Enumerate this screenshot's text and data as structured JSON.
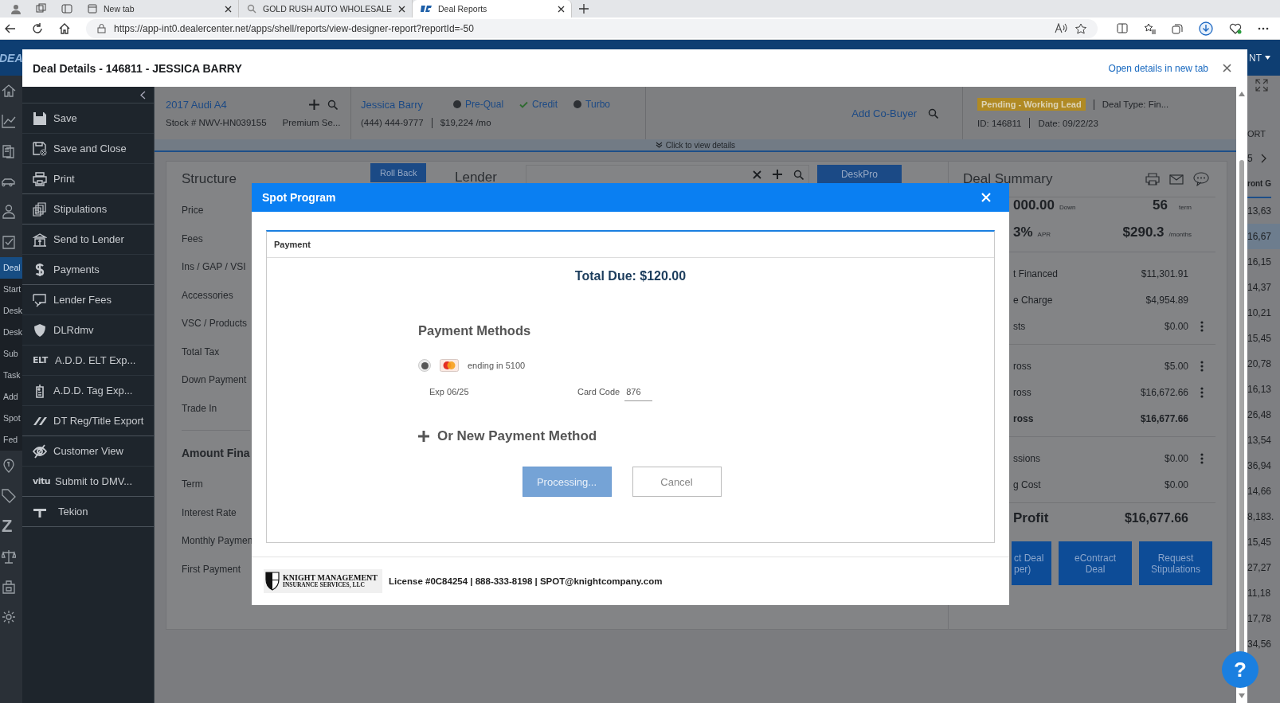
{
  "browser": {
    "tabs": [
      {
        "title": "New tab",
        "selected": false
      },
      {
        "title": "GOLD RUSH AUTO WHOLESALE",
        "selected": false
      },
      {
        "title": "Deal Reports",
        "selected": true
      }
    ],
    "url": "https://app-int0.dealercenter.net/apps/shell/reports/view-designer-report?reportId=-50"
  },
  "app_bar": {
    "logo": "DEA",
    "user": "NT"
  },
  "app_nav": {
    "top_icons": [
      {
        "kind": "home"
      },
      {
        "kind": "chart"
      },
      {
        "kind": "doc"
      },
      {
        "kind": "car"
      },
      {
        "kind": "person"
      },
      {
        "kind": "check"
      }
    ],
    "items": [
      {
        "label": "Deal",
        "selected": true
      },
      {
        "label": "Start",
        "selected": false
      },
      {
        "label": "Desk",
        "selected": false
      },
      {
        "label": "Desk",
        "selected": false
      },
      {
        "label": "Sub",
        "selected": false
      },
      {
        "label": "Task",
        "selected": false
      },
      {
        "label": "Add",
        "selected": false
      },
      {
        "label": "Spot",
        "selected": false
      },
      {
        "label": "Fed",
        "selected": false
      }
    ],
    "bottom_icons": [
      {
        "kind": "pin"
      },
      {
        "kind": "tag"
      },
      {
        "kind": "letter",
        "text": "Z"
      },
      {
        "kind": "scales"
      },
      {
        "kind": "bag"
      },
      {
        "kind": "gear"
      }
    ]
  },
  "drawer": {
    "title": "Deal Details - 146811 - JESSICA BARRY",
    "open_link": "Open details in new tab"
  },
  "action_groups": [
    [
      {
        "label": "Save",
        "kind": "save"
      },
      {
        "label": "Save and Close",
        "kind": "save-close"
      },
      {
        "label": "Print",
        "kind": "print"
      }
    ],
    [
      {
        "label": "Stipulations",
        "kind": "stack"
      }
    ],
    [
      {
        "label": "Send to Lender",
        "kind": "bank"
      },
      {
        "label": "Payments",
        "kind": "dollar"
      }
    ],
    [
      {
        "label": "Lender Fees",
        "kind": "screen"
      },
      {
        "label": "DLRdmv",
        "kind": "shield"
      },
      {
        "label": "A.D.D. ELT Exp...",
        "kind": "text",
        "text": "ELT"
      },
      {
        "label": "A.D.D. Tag Exp...",
        "kind": "tag"
      },
      {
        "label": "DT Reg/Title Export",
        "kind": "slashes"
      }
    ],
    [
      {
        "label": "Customer View",
        "kind": "eye"
      },
      {
        "label": "Submit to DMV...",
        "kind": "text",
        "text": "vitu"
      }
    ],
    [
      {
        "label": "Tekion",
        "kind": "tee"
      }
    ]
  ],
  "deal_header": {
    "vehicle": {
      "title": "2017 Audi A4",
      "stock": "Stock # NWV-HN039155",
      "trim": "Premium Se..."
    },
    "buyer": {
      "name": "Jessica Barry",
      "phone": "(444) 444-9777",
      "payment": "$19,224 /mo",
      "checks": [
        {
          "label": "Pre-Qual",
          "kind": "badge"
        },
        {
          "label": "Credit",
          "kind": "check"
        },
        {
          "label": "Turbo",
          "kind": "badge"
        }
      ]
    },
    "co_buyer": "Add Co-Buyer",
    "status": {
      "label": "Pending - Working Lead",
      "deal_type": "Deal Type: Fin...",
      "id": "ID: 146811",
      "date": "Date: 09/22/23"
    },
    "details_toggle": "Click to view details"
  },
  "structure": {
    "title": "Structure",
    "roll_back": "Roll Back",
    "fields": [
      "Price",
      "Fees",
      "Ins / GAP / VSI",
      "Accessories",
      "VSC / Products",
      "Total Tax",
      "Down Payment",
      "Trade In"
    ],
    "section": "Amount Fina",
    "section_fields": [
      "Term",
      "Interest Rate",
      "Monthly Paymen",
      "First Payment"
    ]
  },
  "lender": {
    "title": "Lender",
    "button": "DeskPro"
  },
  "summary": {
    "title": "Deal Summary",
    "down": "000.00",
    "down_unit": "Down",
    "term": "56",
    "term_unit": "term",
    "apr": "3%",
    "apr_unit": "APR",
    "payment": "$290.3",
    "payment_unit": "/months",
    "groups": [
      [
        {
          "label": "t Financed",
          "value": "$11,301.91",
          "menu": false,
          "bold": false
        },
        {
          "label": "e Charge",
          "value": "$4,954.89",
          "menu": false,
          "bold": false
        },
        {
          "label": "sts",
          "value": "$0.00",
          "menu": true,
          "bold": false
        }
      ],
      [
        {
          "label": "ross",
          "value": "$5.00",
          "menu": true,
          "bold": false
        },
        {
          "label": "ross",
          "value": "$16,672.66",
          "menu": true,
          "bold": false
        },
        {
          "label": "ross",
          "value": "$16,677.66",
          "menu": false,
          "bold": true
        }
      ],
      [
        {
          "label": "ssions",
          "value": "$0.00",
          "menu": true,
          "bold": false
        },
        {
          "label": "g Cost",
          "value": "$0.00",
          "menu": false,
          "bold": false
        }
      ]
    ],
    "profit_label": "Profit",
    "profit": "$16,677.66",
    "buttons": [
      [
        "ct Deal",
        "per)"
      ],
      [
        "eContract Deal"
      ],
      [
        "Request",
        "Stipulations"
      ]
    ]
  },
  "report": {
    "header": "ORT",
    "page": "5",
    "column": "ront G",
    "rows": [
      {
        "value": "13,63",
        "selected": false
      },
      {
        "value": "16,67",
        "selected": true
      },
      {
        "value": "16,15",
        "selected": false
      },
      {
        "value": "14,37",
        "selected": false
      },
      {
        "value": "10,21",
        "selected": false
      },
      {
        "value": "15,45",
        "selected": false
      },
      {
        "value": "20,78",
        "selected": false
      },
      {
        "value": "16,13",
        "selected": false
      },
      {
        "value": "26,48",
        "selected": false
      },
      {
        "value": "13,54",
        "selected": false
      },
      {
        "value": "36,94",
        "selected": false
      },
      {
        "value": "14,66",
        "selected": false
      },
      {
        "value": "8,183.",
        "selected": false
      },
      {
        "value": "15,45",
        "selected": false
      },
      {
        "value": "27,27",
        "selected": false
      },
      {
        "value": "11,18",
        "selected": false
      },
      {
        "value": "17,78",
        "selected": false
      },
      {
        "value": "34,56",
        "selected": false
      }
    ]
  },
  "help": "?",
  "modal": {
    "title": "Spot Program",
    "tab": "Payment",
    "total_due": "Total Due: $120.00",
    "methods_title": "Payment Methods",
    "card": {
      "selected": true,
      "label": "ending in 5100",
      "exp": "Exp 06/25",
      "code_label": "Card Code",
      "code": "876"
    },
    "new_method": "Or New Payment Method",
    "buttons": [
      {
        "label": "Processing...",
        "kind": "primary"
      },
      {
        "label": "Cancel",
        "kind": "secondary"
      }
    ],
    "footer": {
      "logo_line1": "KNIGHT MANAGEMENT",
      "logo_line2": "INSURANCE SERVICES, LLC",
      "info": "License #0C84254 | 888-333-8198 | SPOT@knightcompany.com"
    }
  }
}
